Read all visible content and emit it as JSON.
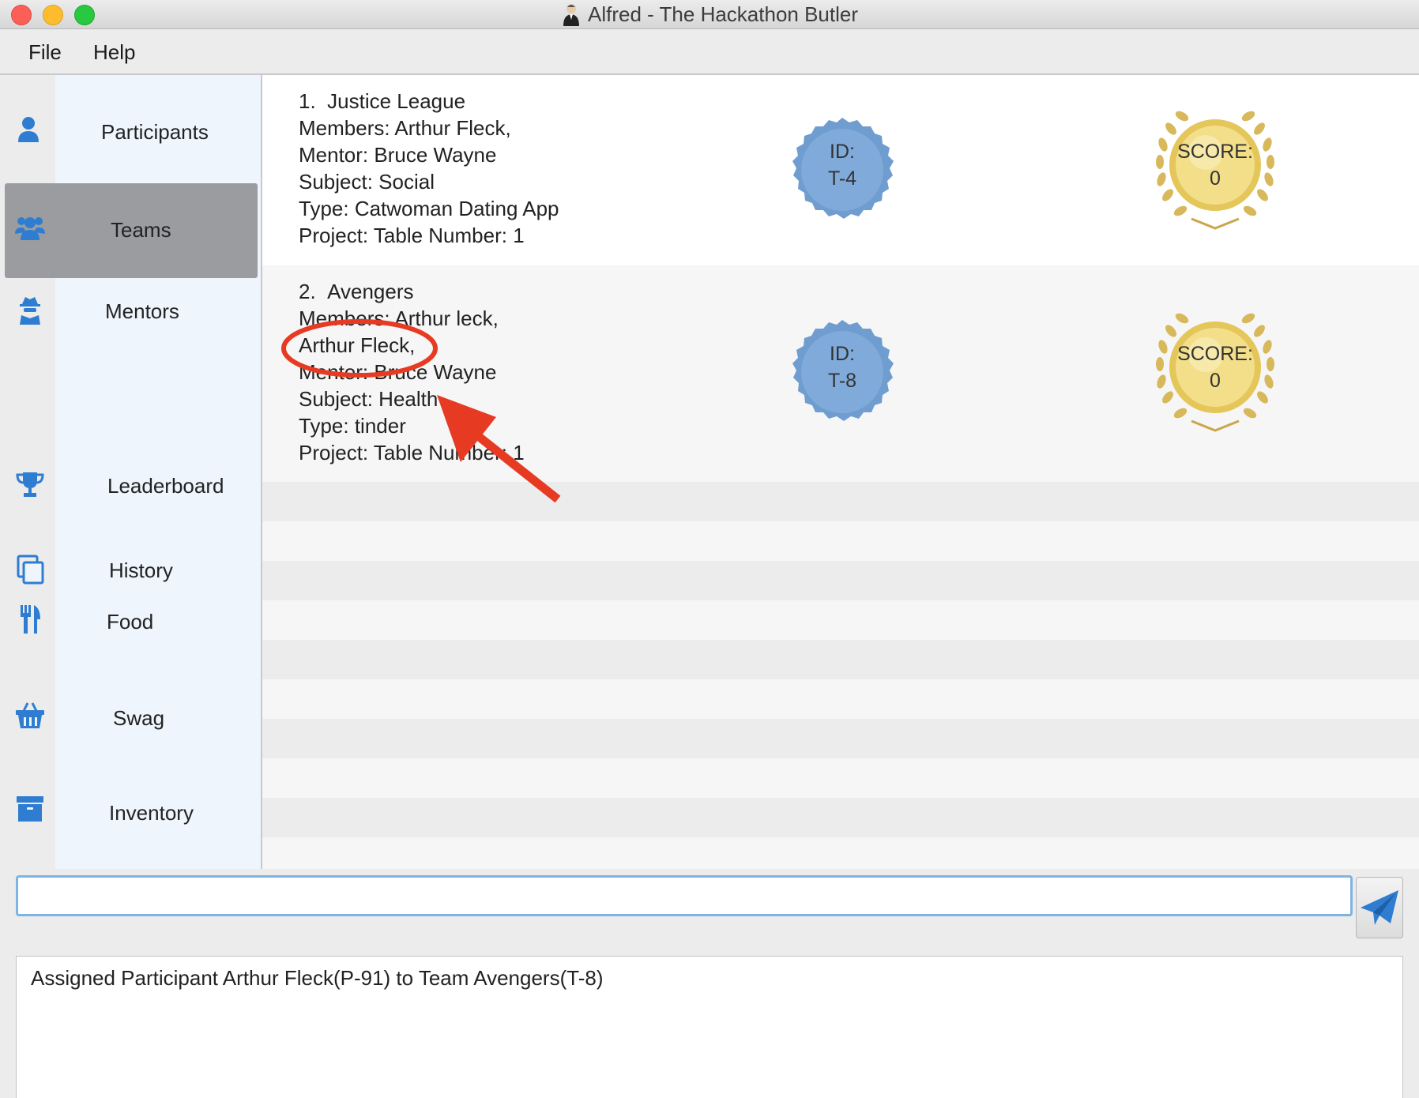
{
  "window": {
    "title": "Alfred - The Hackathon Butler"
  },
  "menu": {
    "file": "File",
    "help": "Help"
  },
  "sidebar": {
    "items": [
      {
        "label": "Participants",
        "icon": "user-icon"
      },
      {
        "label": "Teams",
        "icon": "users-icon",
        "active": true
      },
      {
        "label": "Mentors",
        "icon": "user-secret-icon"
      },
      {
        "label": "Leaderboard",
        "icon": "trophy-icon"
      },
      {
        "label": "History",
        "icon": "copy-icon"
      },
      {
        "label": "Food",
        "icon": "utensils-icon"
      },
      {
        "label": "Swag",
        "icon": "shopping-basket-icon"
      },
      {
        "label": "Inventory",
        "icon": "archive-icon"
      }
    ]
  },
  "teams": [
    {
      "index": "1.",
      "name": "Justice League",
      "members": "Members: Arthur Fleck,",
      "mentor": "Mentor: Bruce Wayne",
      "subject": "Subject: Social",
      "type": "Type: Catwoman Dating App",
      "project": "Project:  Table Number: 1",
      "id_label": "ID:",
      "id": "T-4",
      "score_label": "SCORE:",
      "score": "0"
    },
    {
      "index": "2.",
      "name": "Avengers",
      "members": "Members: Arthur leck,",
      "members_extra": "Arthur Fleck,",
      "mentor": "Mentor: Bruce Wayne",
      "subject": "Subject: Health",
      "type": "Type: tinder",
      "project": "Project:  Table Number: 1",
      "id_label": "ID:",
      "id": "T-8",
      "score_label": "SCORE:",
      "score": "0"
    }
  ],
  "command": {
    "value": "",
    "placeholder": ""
  },
  "result": {
    "text": "Assigned Participant Arthur Fleck(P-91) to Team Avengers(T-8)"
  },
  "colors": {
    "accent": "#2f7dd1",
    "badge": "#7aa6d8",
    "annotation": "#e63b22",
    "sidebar": "#eef5fd",
    "active_tab": "#9b9ca0"
  }
}
